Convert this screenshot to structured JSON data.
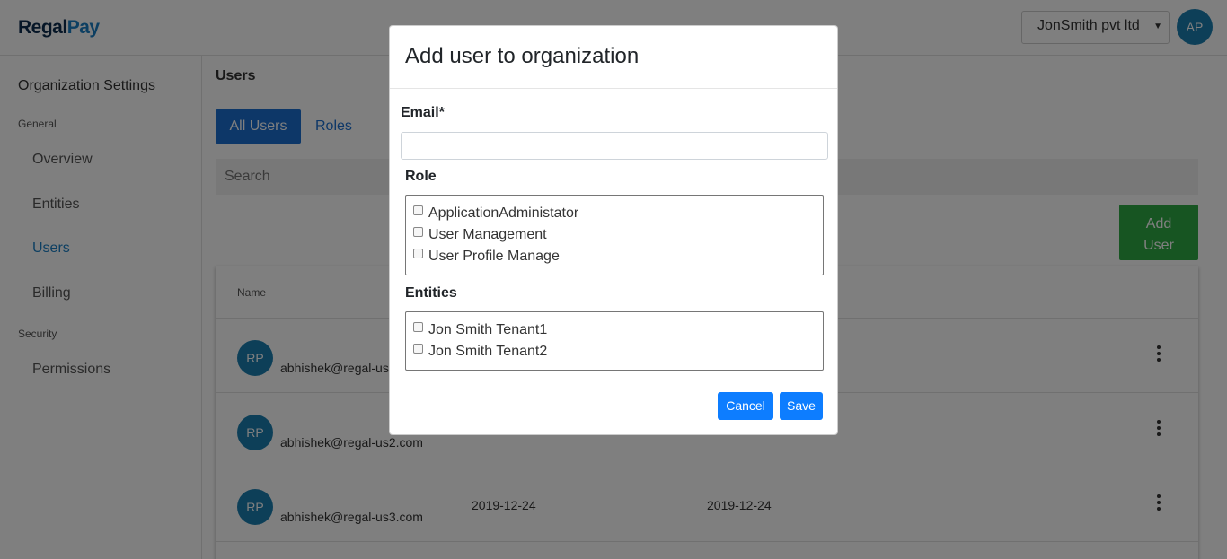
{
  "header": {
    "logo_part1": "Regal",
    "logo_part2": "Pay",
    "org_selected": "JonSmith pvt ltd",
    "user_initials": "AP"
  },
  "sidebar": {
    "title": "Organization Settings",
    "general_label": "General",
    "security_label": "Security",
    "items": [
      {
        "label": "Overview"
      },
      {
        "label": "Entities"
      },
      {
        "label": "Users"
      },
      {
        "label": "Billing"
      },
      {
        "label": "Permissions"
      }
    ]
  },
  "main": {
    "title": "Users",
    "tab_all_users": "All Users",
    "tab_roles": "Roles",
    "search_placeholder": "Search",
    "add_user_line1": "Add",
    "add_user_line2": "User",
    "table": {
      "header_name": "Name",
      "rows": [
        {
          "initials": "RP",
          "email": "abhishek@regal-us1.com",
          "date1": "",
          "date2": ""
        },
        {
          "initials": "RP",
          "email": "abhishek@regal-us2.com",
          "date1": "",
          "date2": ""
        },
        {
          "initials": "RP",
          "email": "abhishek@regal-us3.com",
          "date1": "2019-12-24",
          "date2": "2019-12-24"
        }
      ]
    }
  },
  "modal": {
    "title": "Add user to organization",
    "email_label": "Email*",
    "email_value": "",
    "role_label": "Role",
    "roles": [
      "ApplicationAdministator",
      "User Management",
      "User Profile Manage"
    ],
    "entities_label": "Entities",
    "entities": [
      "Jon Smith Tenant1",
      "Jon Smith Tenant2"
    ],
    "cancel_label": "Cancel",
    "save_label": "Save"
  }
}
